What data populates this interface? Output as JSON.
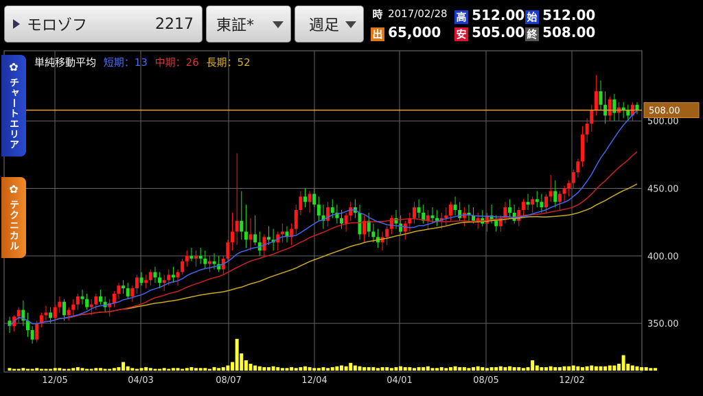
{
  "header": {
    "stock_name": "モロゾフ",
    "stock_code": "2217",
    "market": "東証*",
    "period": "週足",
    "date_label": "時",
    "date": "2017/02/28",
    "volume_label": "出",
    "volume": "65,000",
    "high_label": "高",
    "high": "512.00",
    "low_label": "安",
    "low": "505.00",
    "open_label": "始",
    "open": "512.00",
    "close_label": "終",
    "close": "508.00"
  },
  "side_tabs": {
    "chart_area": "チャートエリア",
    "technical": "テクニカル"
  },
  "legend": {
    "title": "単純移動平均",
    "short": "短期：13",
    "mid": "中期：26",
    "long": "長期：52"
  },
  "colors": {
    "up": "#ff1a1a",
    "down": "#22dd22",
    "volume": "#ffff33",
    "ma_short": "#4466ee",
    "ma_mid": "#cc2222",
    "ma_long": "#ccaa22",
    "price_line": "#f0a030",
    "chart_area_tab": "#1b33a0",
    "technical_tab": "#e07818"
  },
  "chart_data": {
    "type": "candlestick",
    "ylim": [
      315,
      552
    ],
    "y_ticks": [
      350,
      400,
      450,
      500
    ],
    "y_tick_labels": [
      "350.00",
      "400.00",
      "450.00",
      "500.00"
    ],
    "x_tick_labels": [
      "12/05",
      "04/03",
      "08/07",
      "12/04",
      "04/01",
      "08/05",
      "12/02"
    ],
    "current_price": 508,
    "current_price_label": "508.00",
    "weeks": 143,
    "ohlc": [
      [
        352,
        355,
        343,
        348
      ],
      [
        348,
        356,
        344,
        355
      ],
      [
        355,
        362,
        350,
        360
      ],
      [
        360,
        367,
        348,
        352
      ],
      [
        352,
        358,
        340,
        345
      ],
      [
        345,
        348,
        335,
        338
      ],
      [
        338,
        352,
        336,
        350
      ],
      [
        350,
        358,
        347,
        356
      ],
      [
        356,
        363,
        352,
        358
      ],
      [
        358,
        362,
        350,
        354
      ],
      [
        354,
        364,
        352,
        362
      ],
      [
        362,
        370,
        358,
        366
      ],
      [
        366,
        368,
        352,
        356
      ],
      [
        356,
        362,
        352,
        360
      ],
      [
        360,
        368,
        356,
        364
      ],
      [
        364,
        372,
        360,
        370
      ],
      [
        370,
        375,
        364,
        368
      ],
      [
        368,
        372,
        360,
        362
      ],
      [
        362,
        368,
        356,
        364
      ],
      [
        364,
        372,
        360,
        370
      ],
      [
        370,
        375,
        364,
        366
      ],
      [
        366,
        370,
        358,
        362
      ],
      [
        362,
        368,
        355,
        365
      ],
      [
        365,
        374,
        362,
        372
      ],
      [
        372,
        380,
        368,
        378
      ],
      [
        378,
        382,
        372,
        376
      ],
      [
        376,
        380,
        368,
        370
      ],
      [
        370,
        378,
        366,
        376
      ],
      [
        376,
        386,
        372,
        384
      ],
      [
        384,
        388,
        378,
        380
      ],
      [
        380,
        386,
        376,
        382
      ],
      [
        382,
        390,
        378,
        388
      ],
      [
        388,
        392,
        380,
        384
      ],
      [
        384,
        388,
        376,
        380
      ],
      [
        380,
        386,
        374,
        382
      ],
      [
        382,
        390,
        378,
        386
      ],
      [
        386,
        392,
        380,
        384
      ],
      [
        384,
        390,
        378,
        388
      ],
      [
        388,
        398,
        386,
        396
      ],
      [
        396,
        404,
        392,
        400
      ],
      [
        400,
        406,
        396,
        398
      ],
      [
        398,
        404,
        392,
        400
      ],
      [
        400,
        406,
        394,
        398
      ],
      [
        398,
        404,
        390,
        394
      ],
      [
        394,
        400,
        388,
        396
      ],
      [
        396,
        402,
        390,
        394
      ],
      [
        394,
        400,
        388,
        390
      ],
      [
        390,
        400,
        386,
        398
      ],
      [
        398,
        412,
        396,
        410
      ],
      [
        410,
        432,
        404,
        418
      ],
      [
        418,
        476,
        408,
        426
      ],
      [
        426,
        448,
        412,
        418
      ],
      [
        418,
        438,
        406,
        412
      ],
      [
        412,
        428,
        404,
        416
      ],
      [
        416,
        430,
        408,
        410
      ],
      [
        410,
        418,
        400,
        404
      ],
      [
        404,
        416,
        400,
        414
      ],
      [
        414,
        422,
        408,
        412
      ],
      [
        412,
        420,
        404,
        410
      ],
      [
        410,
        418,
        404,
        416
      ],
      [
        416,
        424,
        410,
        418
      ],
      [
        418,
        422,
        410,
        414
      ],
      [
        414,
        424,
        408,
        420
      ],
      [
        420,
        438,
        416,
        434
      ],
      [
        434,
        448,
        430,
        444
      ],
      [
        444,
        450,
        436,
        440
      ],
      [
        440,
        448,
        432,
        446
      ],
      [
        446,
        450,
        436,
        438
      ],
      [
        438,
        444,
        426,
        430
      ],
      [
        430,
        438,
        420,
        426
      ],
      [
        426,
        440,
        422,
        436
      ],
      [
        436,
        442,
        428,
        432
      ],
      [
        432,
        438,
        424,
        428
      ],
      [
        428,
        434,
        420,
        424
      ],
      [
        424,
        432,
        418,
        430
      ],
      [
        430,
        440,
        426,
        436
      ],
      [
        436,
        442,
        428,
        432
      ],
      [
        432,
        438,
        412,
        416
      ],
      [
        416,
        430,
        410,
        426
      ],
      [
        426,
        432,
        414,
        418
      ],
      [
        418,
        424,
        410,
        414
      ],
      [
        414,
        420,
        406,
        410
      ],
      [
        410,
        418,
        404,
        414
      ],
      [
        414,
        422,
        408,
        420
      ],
      [
        420,
        430,
        416,
        428
      ],
      [
        428,
        434,
        420,
        424
      ],
      [
        424,
        430,
        416,
        418
      ],
      [
        418,
        426,
        412,
        424
      ],
      [
        424,
        432,
        418,
        428
      ],
      [
        428,
        440,
        424,
        436
      ],
      [
        436,
        442,
        428,
        432
      ],
      [
        432,
        438,
        424,
        426
      ],
      [
        426,
        434,
        420,
        430
      ],
      [
        430,
        436,
        424,
        428
      ],
      [
        428,
        434,
        422,
        426
      ],
      [
        426,
        432,
        420,
        428
      ],
      [
        428,
        436,
        422,
        430
      ],
      [
        430,
        440,
        426,
        438
      ],
      [
        438,
        444,
        430,
        434
      ],
      [
        434,
        440,
        426,
        428
      ],
      [
        428,
        436,
        422,
        432
      ],
      [
        432,
        438,
        426,
        430
      ],
      [
        430,
        436,
        424,
        426
      ],
      [
        426,
        432,
        420,
        428
      ],
      [
        428,
        434,
        422,
        424
      ],
      [
        424,
        432,
        418,
        430
      ],
      [
        430,
        438,
        424,
        426
      ],
      [
        426,
        430,
        418,
        422
      ],
      [
        422,
        430,
        418,
        428
      ],
      [
        428,
        440,
        424,
        436
      ],
      [
        436,
        442,
        428,
        432
      ],
      [
        432,
        438,
        424,
        426
      ],
      [
        426,
        436,
        422,
        434
      ],
      [
        434,
        442,
        430,
        440
      ],
      [
        440,
        446,
        434,
        438
      ],
      [
        438,
        444,
        432,
        442
      ],
      [
        442,
        448,
        436,
        440
      ],
      [
        440,
        446,
        432,
        436
      ],
      [
        436,
        446,
        432,
        444
      ],
      [
        444,
        460,
        440,
        448
      ],
      [
        448,
        456,
        436,
        440
      ],
      [
        440,
        448,
        434,
        446
      ],
      [
        446,
        452,
        440,
        450
      ],
      [
        450,
        456,
        444,
        454
      ],
      [
        454,
        464,
        450,
        462
      ],
      [
        462,
        472,
        458,
        470
      ],
      [
        470,
        496,
        466,
        490
      ],
      [
        490,
        502,
        484,
        498
      ],
      [
        498,
        512,
        492,
        508
      ],
      [
        508,
        534,
        504,
        522
      ],
      [
        522,
        530,
        508,
        512
      ],
      [
        512,
        522,
        498,
        504
      ],
      [
        504,
        518,
        500,
        516
      ],
      [
        516,
        520,
        500,
        506
      ],
      [
        506,
        514,
        500,
        510
      ],
      [
        510,
        514,
        502,
        508
      ],
      [
        508,
        512,
        500,
        504
      ],
      [
        504,
        514,
        500,
        512
      ],
      [
        512,
        514,
        505,
        508
      ]
    ],
    "ma_short": {
      "name": "短期",
      "period": 13
    },
    "ma_mid": {
      "name": "中期",
      "period": 26
    },
    "ma_long": {
      "name": "長期",
      "period": 52
    },
    "volume_max": 40,
    "volume": [
      3,
      2,
      2,
      3,
      2,
      2,
      3,
      2,
      2,
      2,
      3,
      3,
      2,
      2,
      3,
      4,
      3,
      2,
      2,
      3,
      3,
      2,
      2,
      3,
      4,
      10,
      5,
      3,
      2,
      3,
      4,
      3,
      2,
      2,
      3,
      2,
      3,
      3,
      2,
      3,
      4,
      3,
      3,
      3,
      2,
      4,
      3,
      4,
      6,
      10,
      37,
      20,
      12,
      8,
      6,
      5,
      4,
      4,
      5,
      4,
      3,
      3,
      4,
      3,
      4,
      5,
      4,
      3,
      3,
      4,
      3,
      4,
      5,
      6,
      5,
      9,
      6,
      5,
      4,
      4,
      4,
      3,
      4,
      4,
      3,
      4,
      5,
      4,
      4,
      3,
      4,
      4,
      5,
      3,
      3,
      4,
      3,
      4,
      5,
      4,
      4,
      3,
      4,
      5,
      4,
      3,
      4,
      4,
      5,
      4,
      5,
      4,
      4,
      3,
      4,
      12,
      6,
      4,
      4,
      5,
      4,
      4,
      5,
      5,
      6,
      5,
      4,
      5,
      6,
      5,
      5,
      5,
      6,
      6,
      8,
      18,
      8,
      6,
      5,
      4,
      4,
      3,
      3
    ]
  }
}
